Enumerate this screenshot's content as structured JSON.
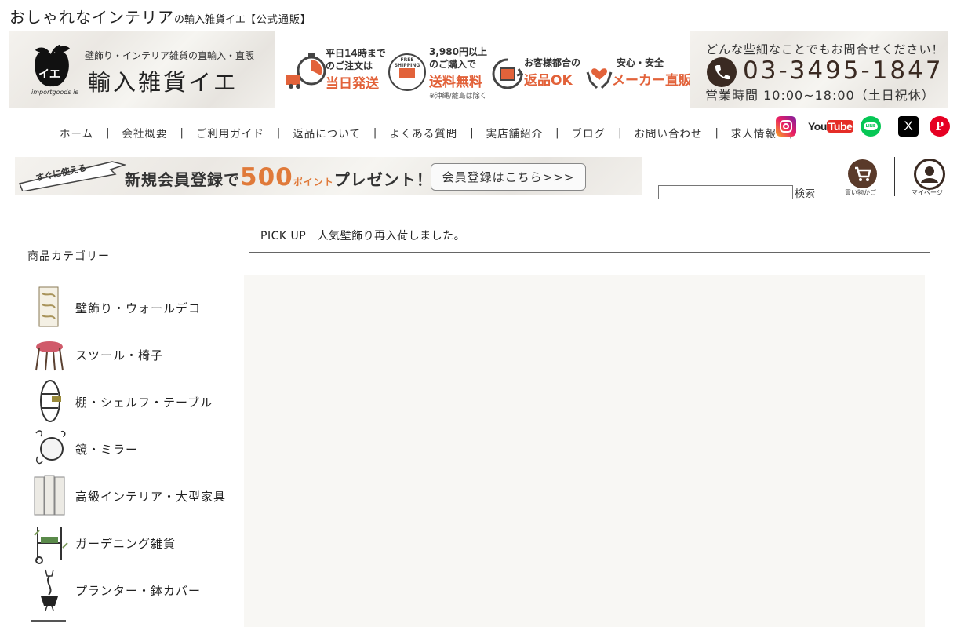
{
  "site_title": {
    "main": "おしゃれなインテリア",
    "small": "の輸入雑貨イエ",
    "bracket": "【公式通販】"
  },
  "logo": {
    "tagline": "壁飾り・インテリア雑貨の直輸入・直販",
    "name": "輸入雑貨イエ",
    "mark": "イエ",
    "sub": "importgoods ie"
  },
  "features": [
    {
      "line1": "平日14時まで",
      "line2": "のご注文は",
      "big": "当日発送"
    },
    {
      "line1": "3,980円以上",
      "line2": "のご購入で",
      "big": "送料無料",
      "note": "※沖縄/離島は除く",
      "badge": "FREE SHIPPING"
    },
    {
      "line1": "お客様都合の",
      "big": "返品OK"
    },
    {
      "line1": "安心・安全",
      "big": "メーカー直販"
    }
  ],
  "contact": {
    "prompt": "どんな些細なことでもお問合せください！",
    "phone": "03-3495-1847",
    "hours": "営業時間 10:00~18:00（土日祝休）"
  },
  "nav": [
    "ホーム",
    "会社概要",
    "ご利用ガイド",
    "返品について",
    "よくある質問",
    "実店舗紹介",
    "ブログ",
    "お問い合わせ",
    "求人情報"
  ],
  "sns": {
    "youtube": "YouTube",
    "line": "LINE",
    "x": "X"
  },
  "promo": {
    "ribbon": "すぐに使える",
    "text_before": "新規会員登録で",
    "points": "500",
    "points_unit": "ポイント",
    "text_after": "プレゼント！",
    "button": "会員登録はこちら>>>"
  },
  "search": {
    "value": "",
    "label": "検索"
  },
  "header_icons": {
    "cart": "買い物かご",
    "mypage": "マイページ"
  },
  "sidebar": {
    "heading": "商品カテゴリー",
    "items": [
      {
        "label": "壁飾り・ウォールデコ"
      },
      {
        "label": "スツール・椅子"
      },
      {
        "label": "棚・シェルフ・テーブル"
      },
      {
        "label": "鏡・ミラー"
      },
      {
        "label": "高級インテリア・大型家具"
      },
      {
        "label": "ガーデニング雑貨"
      },
      {
        "label": "プランター・鉢カバー"
      }
    ]
  },
  "pickup": {
    "title": "PICK UP　人気壁飾り再入荷しました。"
  },
  "colors": {
    "accent_orange": "#e2623a",
    "dark_brown": "#3a2a22",
    "pickup_bg": "#f8f7f4"
  }
}
